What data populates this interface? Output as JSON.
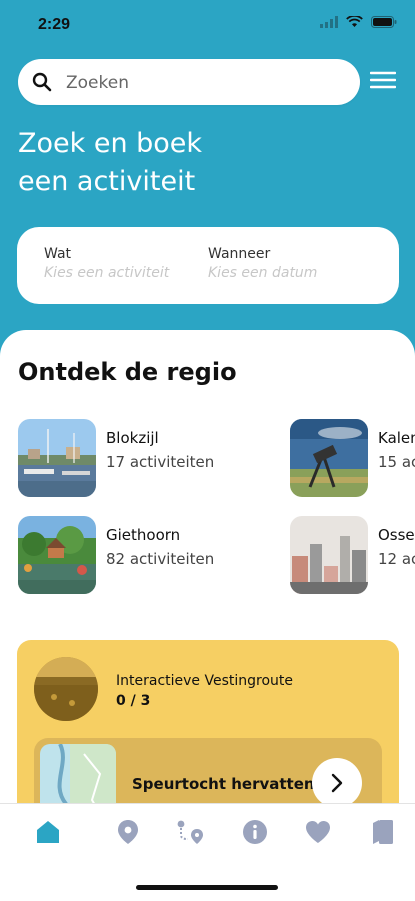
{
  "status_bar": {
    "time": "2:29"
  },
  "search": {
    "placeholder": "Zoeken"
  },
  "hero": {
    "line1": "Zoek en boek",
    "line2": "een activiteit"
  },
  "booking_card": {
    "what_label": "Wat",
    "what_placeholder": "Kies een activiteit",
    "when_label": "Wanneer",
    "when_placeholder": "Kies een datum"
  },
  "discover": {
    "title": "Ontdek de regio",
    "regions": [
      {
        "name": "Blokzijl",
        "count": "17 activiteiten"
      },
      {
        "name": "Kalen",
        "count": "15 ac"
      },
      {
        "name": "Giethoorn",
        "count": "82 activiteiten"
      },
      {
        "name": "Osser",
        "count": "12 ac"
      }
    ]
  },
  "route": {
    "title": "Interactieve Vestingroute",
    "progress": "0 / 3",
    "resume_label": "Speurtocht hervatten"
  },
  "tabs": [
    "home-icon",
    "location-pin-icon",
    "route-icon",
    "info-icon",
    "heart-icon",
    "passport-icon"
  ],
  "colors": {
    "accent": "#2ba5c4",
    "card_yellow": "#f6cf63",
    "tab_active": "#2ba5c4",
    "tab_inactive": "#9aa3bd"
  }
}
